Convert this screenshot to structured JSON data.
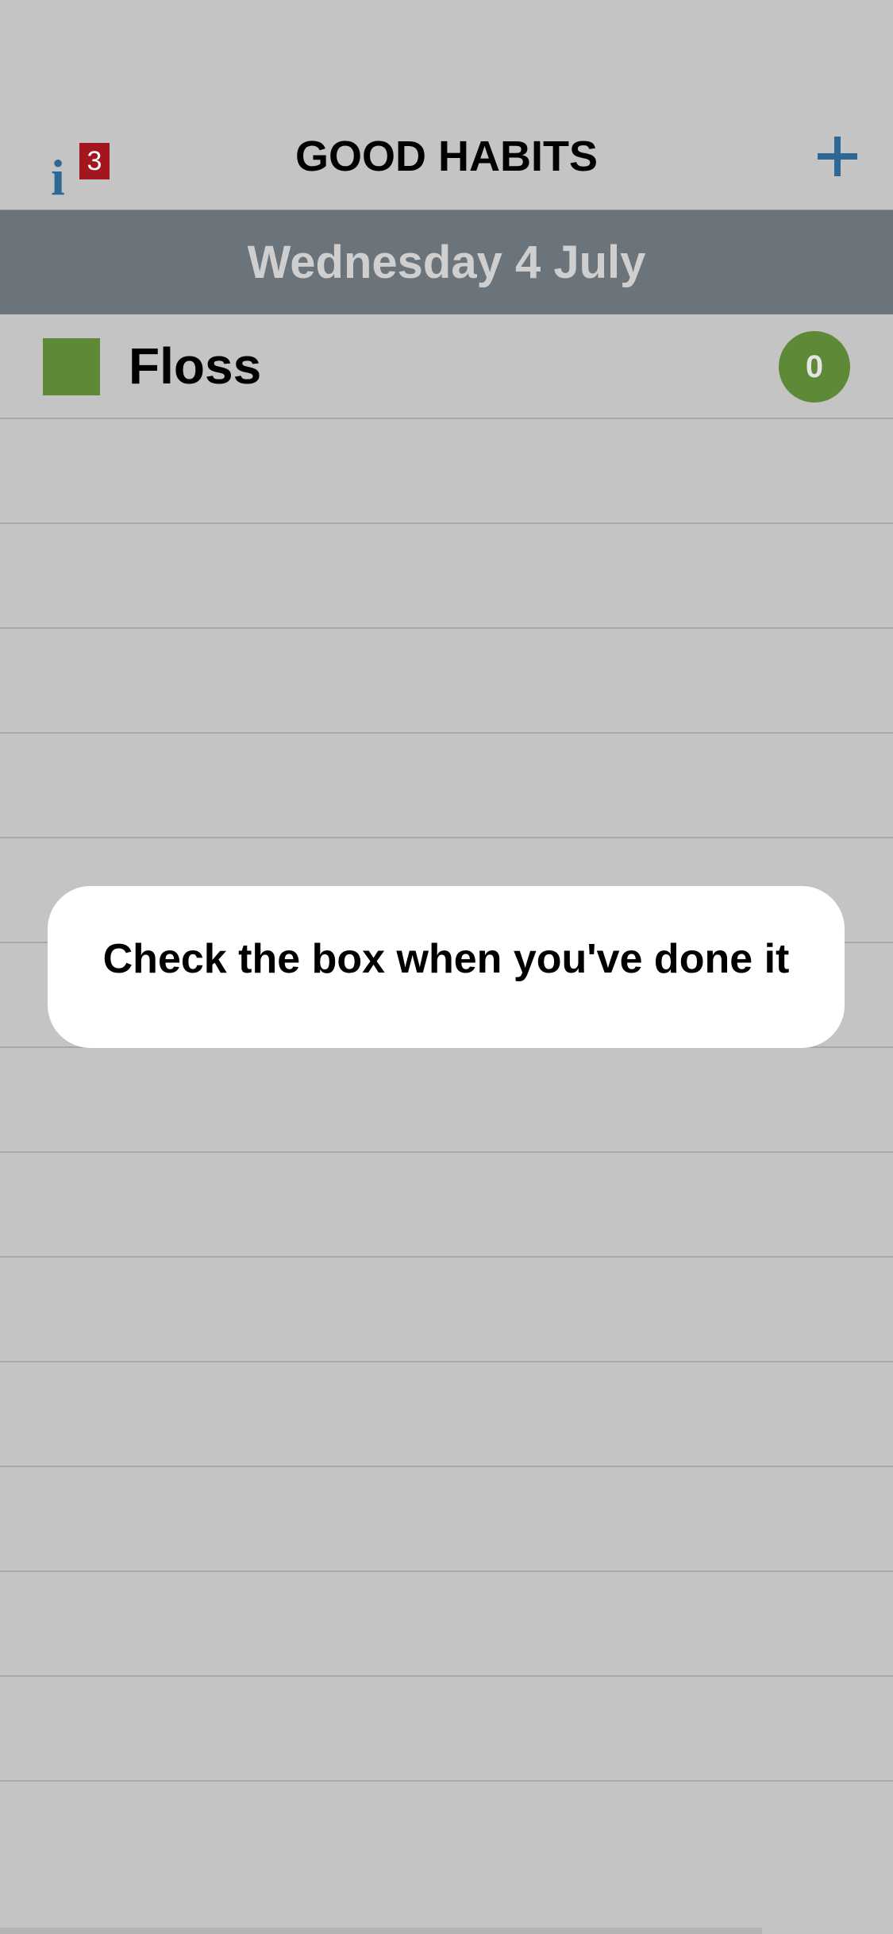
{
  "nav": {
    "title": "GOOD HABITS",
    "info_icon": "info-icon",
    "info_glyph": "i",
    "info_badge": "3",
    "add_icon": "plus-icon",
    "accent_color": "#2f6795",
    "badge_color": "#a3161f"
  },
  "date_header": {
    "label": "Wednesday 4 July"
  },
  "habits": [
    {
      "name": "Floss",
      "count": "0",
      "color": "#5e8a37",
      "checked": false
    }
  ],
  "empty_row_count": 13,
  "toast": {
    "message": "Check the box when you've done it"
  }
}
